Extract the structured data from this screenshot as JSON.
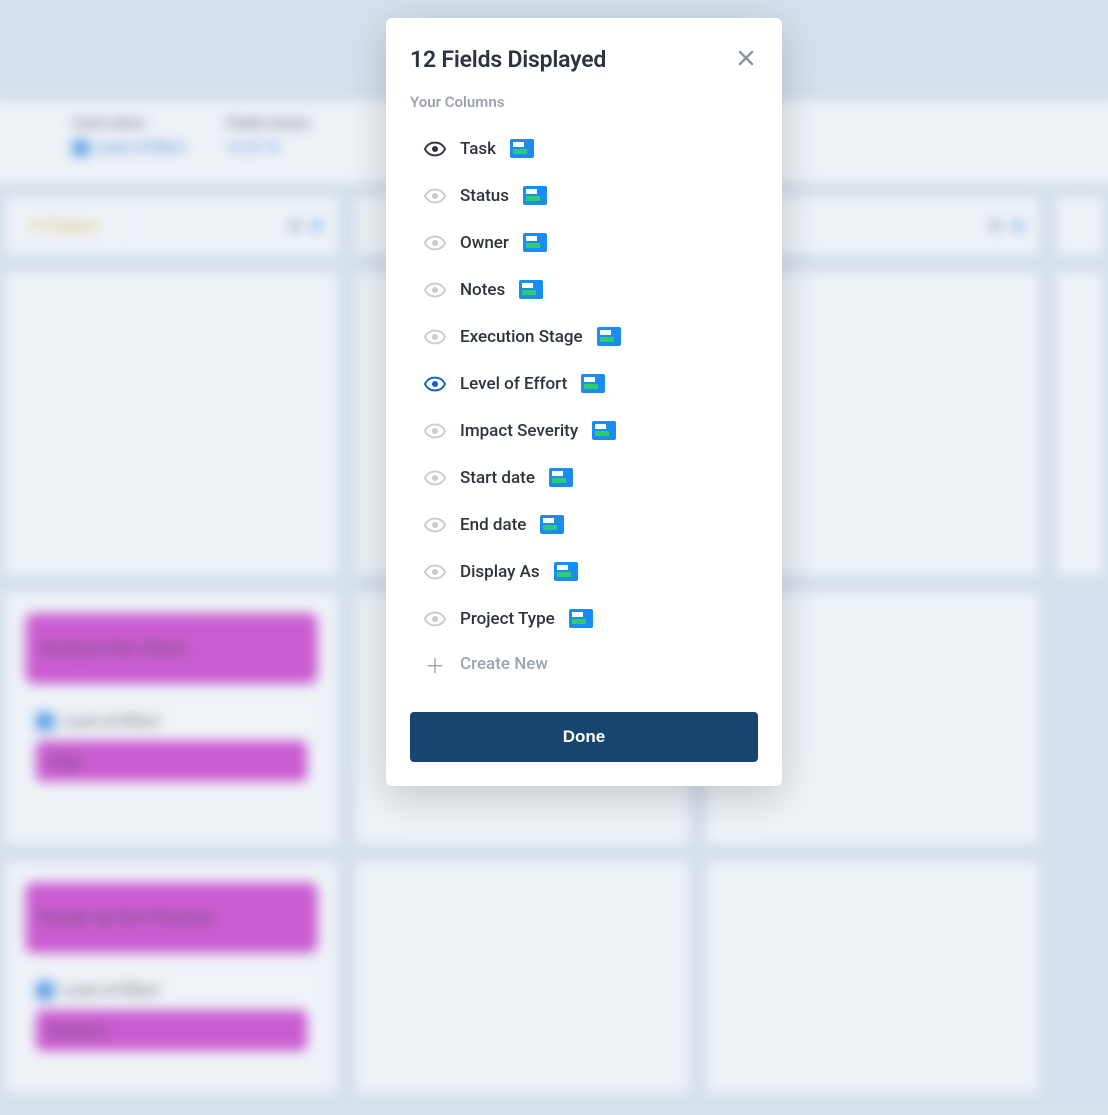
{
  "background": {
    "toolbar": {
      "card_colors_label": "Card colors",
      "card_colors_value": "Level of Effort",
      "fields_shown_label": "Fields shown",
      "fields_shown_value": "12 of 12"
    },
    "lane_title": "In Progress",
    "cards": [
      {
        "title": "Analyze the Glaze",
        "metric_label": "Level of Effort",
        "metric_value": "High"
      },
      {
        "title": "Break up the Plastics",
        "metric_label": "Level of Effort",
        "metric_value": "Medium"
      }
    ]
  },
  "modal": {
    "title": "12 Fields Displayed",
    "section_label": "Your Columns",
    "fields": [
      {
        "label": "Task",
        "state": "dark"
      },
      {
        "label": "Status",
        "state": "muted"
      },
      {
        "label": "Owner",
        "state": "muted"
      },
      {
        "label": "Notes",
        "state": "muted"
      },
      {
        "label": "Execution Stage",
        "state": "muted"
      },
      {
        "label": "Level of Effort",
        "state": "blue"
      },
      {
        "label": "Impact Severity",
        "state": "muted"
      },
      {
        "label": "Start date",
        "state": "muted"
      },
      {
        "label": "End date",
        "state": "muted"
      },
      {
        "label": "Display As",
        "state": "muted"
      },
      {
        "label": "Project Type",
        "state": "muted"
      }
    ],
    "create_new_label": "Create New",
    "done_label": "Done"
  }
}
